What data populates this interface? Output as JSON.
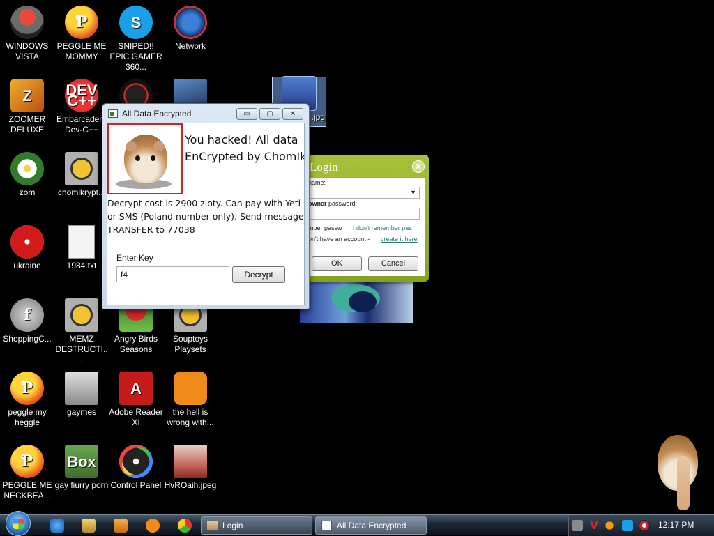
{
  "desktop_icons": [
    {
      "label": "WINDOWS VISTA",
      "icon": "vista-orb-icon"
    },
    {
      "label": "PEGGLE ME MOMMY",
      "icon": "peggle-icon"
    },
    {
      "label": "SNIPED!! EPIC GAMER 360...",
      "icon": "skype-icon"
    },
    {
      "label": "Network",
      "icon": "network-globe-icon"
    },
    {
      "label": "ZOOMER DELUXE",
      "icon": "zoomer-icon"
    },
    {
      "label": "Embarcadero Dev-C++",
      "icon": "dev-cpp-icon"
    },
    {
      "label": "zom",
      "icon": "flower-icon"
    },
    {
      "label": "chomikrypt...",
      "icon": "chomikrypt-icon"
    },
    {
      "label": "ukraine",
      "icon": "radiation-icon"
    },
    {
      "label": "1984.txt",
      "icon": "text-file-icon"
    },
    {
      "label": "ShoppingC...",
      "icon": "flash-icon"
    },
    {
      "label": "MEMZ DESTRUCTI...",
      "icon": "memz-icon"
    },
    {
      "label": "Angry Birds Seasons",
      "icon": "angry-birds-icon"
    },
    {
      "label": "Souptoys Playsets",
      "icon": "souptoys-icon"
    },
    {
      "label": "peggle my heggle",
      "icon": "peggle-icon"
    },
    {
      "label": "gaymes",
      "icon": "folder-icon"
    },
    {
      "label": "Adobe Reader XI",
      "icon": "adobe-reader-icon"
    },
    {
      "label": "the hell is wrong with...",
      "icon": "uc-browser-icon"
    },
    {
      "label": "PEGGLE ME NECKBEA...",
      "icon": "peggle-icon"
    },
    {
      "label": "gay fiurry porn",
      "icon": "box-icon"
    },
    {
      "label": "Control Panel",
      "icon": "control-panel-icon"
    },
    {
      "label": "HvROaih.jpeg",
      "icon": "image-file-icon"
    },
    {
      "label": ".jpg",
      "icon": "image-file-icon"
    }
  ],
  "icon_glyphs": {
    "peggle": "P",
    "skype": "S",
    "zoomer": "Z",
    "dev": "DEV C++",
    "flash": "f",
    "adobe": "A",
    "box": "Box"
  },
  "login_dialog": {
    "title": "Login",
    "close_glyph": "×",
    "username_label": "name:",
    "password_label_bold": "owner",
    "password_label_rest": " password:",
    "remember_label": "mber passw",
    "forgot_link": "I don't remember pas",
    "no_account_text": "on't have an account - ",
    "create_link": "create it here",
    "ok_label": "OK",
    "cancel_label": "Cancel",
    "dropdown_arrow": "▼"
  },
  "ransom_window": {
    "title": "All Data Encrypted",
    "minimize_glyph": "▭",
    "maximize_glyph": "▢",
    "close_glyph": "✕",
    "headline_line1": "You hacked! All data",
    "headline_line2": "EnCrypted by ChomIk",
    "description": "Decrypt cost is 2900 zloty. Can pay with Yeti or SMS (Poland number only). Send message TRANSFER to 77038",
    "enter_key_label": "Enter Key",
    "key_value": "f4",
    "decrypt_label": "Decrypt"
  },
  "taskbar": {
    "tasks": [
      {
        "label": "Login"
      },
      {
        "label": "All Data Encrypted"
      }
    ],
    "clock": "12:17 PM",
    "colors": {
      "accent": "#2a6fb8"
    }
  }
}
